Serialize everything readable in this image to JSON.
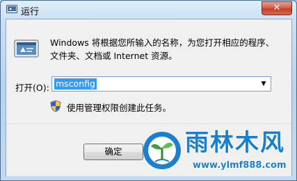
{
  "window": {
    "title": "运行",
    "close_label": "✕"
  },
  "dialog": {
    "description_line1": "Windows 将根据您所输入的名称，为您打开相应的程序、",
    "description_line2": "文件夹、文档或 Internet 资源。",
    "open_label": "打开(O):",
    "open_value": "msconfig",
    "admin_note": "使用管理权限创建此任务。",
    "ok_label": "确定"
  },
  "watermark": {
    "title": "雨林木风",
    "url": "www.ylmf888.com"
  },
  "icons": {
    "title": "run-icon",
    "dialog": "run-program-icon",
    "admin": "uac-shield-icon",
    "dropdown": "chevron-down-icon",
    "watermark": "ylmf-logo-icon"
  },
  "colors": {
    "selection": "#3399ff",
    "close_button": "#c0402a",
    "watermark": "#1a7fcf",
    "frame": "#b9d3ee"
  }
}
